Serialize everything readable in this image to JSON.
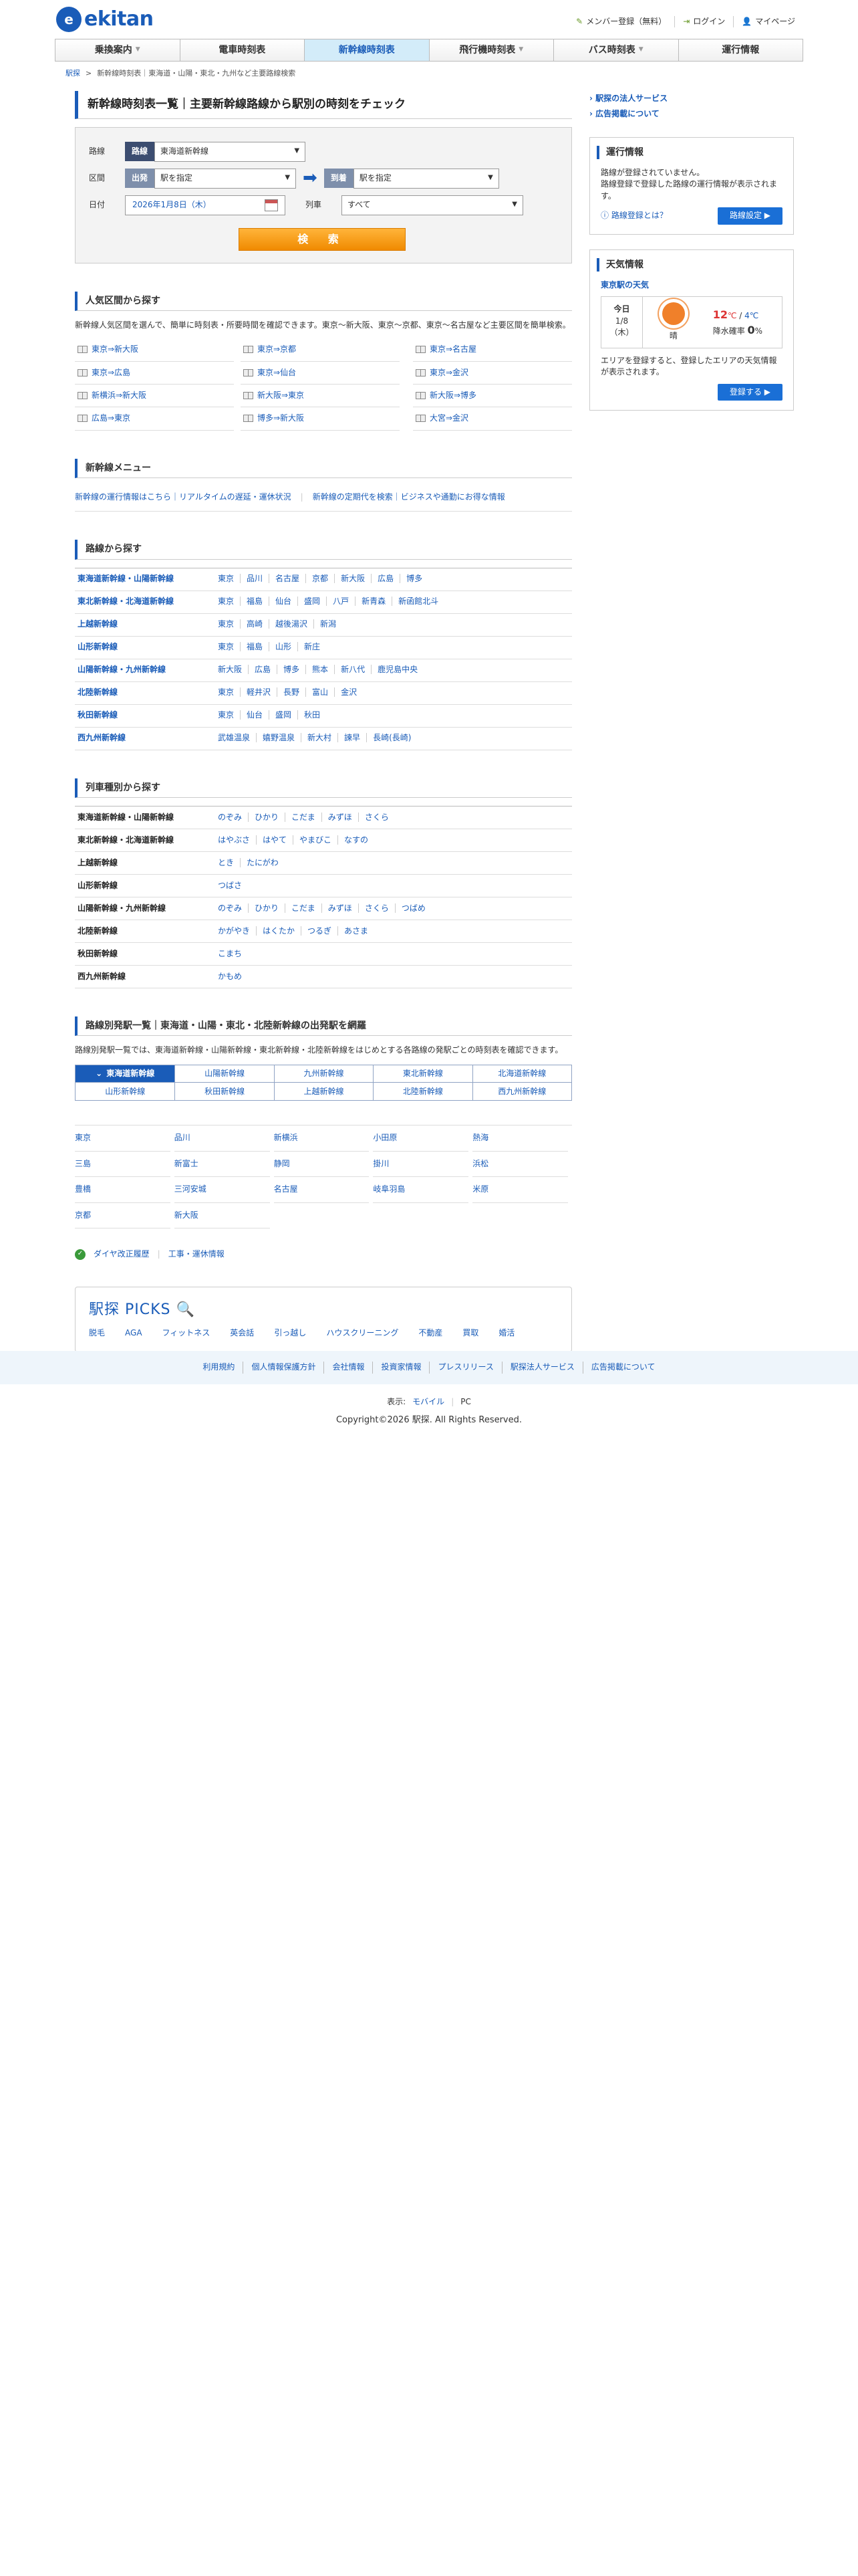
{
  "logo": {
    "mark": "e",
    "text": "ekitan"
  },
  "header_links": [
    {
      "label": "メンバー登録（無料）",
      "icon": "pencil-icon"
    },
    {
      "label": "ログイン",
      "icon": "login-icon"
    },
    {
      "label": "マイページ",
      "icon": "user-icon"
    }
  ],
  "gnav": [
    {
      "label": "乗換案内",
      "caret": "▼"
    },
    {
      "label": "電車時刻表",
      "caret": ""
    },
    {
      "label": "新幹線時刻表",
      "caret": ""
    },
    {
      "label": "飛行機時刻表",
      "caret": "▼"
    },
    {
      "label": "バス時刻表",
      "caret": "▼"
    },
    {
      "label": "運行情報",
      "caret": ""
    }
  ],
  "breadcrumb": {
    "home": "駅探",
    "sep": ">",
    "current": "新幹線時刻表｜東海道・山陽・東北・九州など主要路線検索"
  },
  "page_title": "新幹線時刻表一覧｜主要新幹線路線から駅別の時刻をチェック",
  "search": {
    "route_label": "路線",
    "route_tag": "路線",
    "route_value": "東海道新幹線",
    "section_label": "区間",
    "dep_tag": "出発",
    "dep_value": "駅を指定",
    "arr_tag": "到着",
    "arr_value": "駅を指定",
    "date_label": "日付",
    "date_value": "2026年1月8日（木）",
    "train_label": "列車",
    "train_value": "すべて",
    "button": "検 索",
    "tri": "▼",
    "arrow": "➡"
  },
  "popular": {
    "title": "人気区間から探す",
    "desc": "新幹線人気区間を選んで、簡単に時刻表・所要時間を確認できます。東京〜新大阪、東京〜京都、東京〜名古屋など主要区間を簡単検索。",
    "items": [
      "東京⇒新大阪",
      "東京⇒京都",
      "東京⇒名古屋",
      "東京⇒広島",
      "東京⇒仙台",
      "東京⇒金沢",
      "新横浜⇒新大阪",
      "新大阪⇒東京",
      "新大阪⇒博多",
      "広島⇒東京",
      "博多⇒新大阪",
      "大宮⇒金沢"
    ]
  },
  "menu": {
    "title": "新幹線メニュー",
    "link1": "新幹線の運行情報はこちら｜リアルタイムの遅延・運休状況",
    "link2": "新幹線の定期代を検索｜ビジネスや通勤にお得な情報",
    "sep": "|"
  },
  "lines": {
    "title": "路線から探す",
    "rows": [
      {
        "name": "東海道新幹線・山陽新幹線",
        "stations": [
          "東京",
          "品川",
          "名古屋",
          "京都",
          "新大阪",
          "広島",
          "博多"
        ]
      },
      {
        "name": "東北新幹線・北海道新幹線",
        "stations": [
          "東京",
          "福島",
          "仙台",
          "盛岡",
          "八戸",
          "新青森",
          "新函館北斗"
        ]
      },
      {
        "name": "上越新幹線",
        "stations": [
          "東京",
          "高崎",
          "越後湯沢",
          "新潟"
        ]
      },
      {
        "name": "山形新幹線",
        "stations": [
          "東京",
          "福島",
          "山形",
          "新庄"
        ]
      },
      {
        "name": "山陽新幹線・九州新幹線",
        "stations": [
          "新大阪",
          "広島",
          "博多",
          "熊本",
          "新八代",
          "鹿児島中央"
        ]
      },
      {
        "name": "北陸新幹線",
        "stations": [
          "東京",
          "軽井沢",
          "長野",
          "富山",
          "金沢"
        ]
      },
      {
        "name": "秋田新幹線",
        "stations": [
          "東京",
          "仙台",
          "盛岡",
          "秋田"
        ]
      },
      {
        "name": "西九州新幹線",
        "stations": [
          "武雄温泉",
          "嬉野温泉",
          "新大村",
          "諫早",
          "長崎(長崎)"
        ]
      }
    ]
  },
  "types": {
    "title": "列車種別から探す",
    "rows": [
      {
        "name": "東海道新幹線・山陽新幹線",
        "trains": [
          "のぞみ",
          "ひかり",
          "こだま",
          "みずほ",
          "さくら"
        ]
      },
      {
        "name": "東北新幹線・北海道新幹線",
        "trains": [
          "はやぶさ",
          "はやて",
          "やまびこ",
          "なすの"
        ]
      },
      {
        "name": "上越新幹線",
        "trains": [
          "とき",
          "たにがわ"
        ]
      },
      {
        "name": "山形新幹線",
        "trains": [
          "つばさ"
        ]
      },
      {
        "name": "山陽新幹線・九州新幹線",
        "trains": [
          "のぞみ",
          "ひかり",
          "こだま",
          "みずほ",
          "さくら",
          "つばめ"
        ]
      },
      {
        "name": "北陸新幹線",
        "trains": [
          "かがやき",
          "はくたか",
          "つるぎ",
          "あさま"
        ]
      },
      {
        "name": "秋田新幹線",
        "trains": [
          "こまち"
        ]
      },
      {
        "name": "西九州新幹線",
        "trains": [
          "かもめ"
        ]
      }
    ]
  },
  "station_list": {
    "title": "路線別発駅一覧｜東海道・山陽・東北・北陸新幹線の出発駅を網羅",
    "desc": "路線別発駅一覧では、東海道新幹線・山陽新幹線・東北新幹線・北陸新幹線をはじめとする各路線の発駅ごとの時刻表を確認できます。",
    "tabs": [
      "東海道新幹線",
      "山陽新幹線",
      "九州新幹線",
      "東北新幹線",
      "北海道新幹線",
      "山形新幹線",
      "秋田新幹線",
      "上越新幹線",
      "北陸新幹線",
      "西九州新幹線"
    ],
    "active_mark": "⌄",
    "stations": [
      "東京",
      "品川",
      "新横浜",
      "小田原",
      "熱海",
      "三島",
      "新富士",
      "静岡",
      "掛川",
      "浜松",
      "豊橋",
      "三河安城",
      "名古屋",
      "岐阜羽島",
      "米原",
      "京都",
      "新大阪"
    ]
  },
  "bottom_links": {
    "icon": "green-circle-icon",
    "link1": "ダイヤ改正履歴",
    "link2": "工事・運休情報"
  },
  "picks": {
    "logo": "駅探 PICKS",
    "links": [
      "脱毛",
      "AGA",
      "フィットネス",
      "英会話",
      "引っ越し",
      "ハウスクリーニング",
      "不動産",
      "買取",
      "婚活"
    ]
  },
  "side": {
    "links": [
      "駅探の法人サービス",
      "広告掲載について"
    ],
    "unko": {
      "title": "運行情報",
      "text1": "路線が登録されていません。",
      "text2": "路線登録で登録した路線の運行情報が表示されます。",
      "help": "路線登録とは？",
      "btn": "路線設定"
    },
    "weather": {
      "title": "天気情報",
      "station": "東京駅の天気",
      "today": "今日",
      "date": "1/8",
      "dow": "（木）",
      "cond": "晴",
      "hi": "12",
      "lo": "4",
      "unit": "℃",
      "pop_label": "降水確率",
      "pop": "0",
      "pop_unit": "%",
      "note": "エリアを登録すると、登録したエリアの天気情報が表示されます。",
      "btn": "登録する"
    }
  },
  "footer": {
    "links": [
      "利用規約",
      "個人情報保護方針",
      "会社情報",
      "投資家情報",
      "プレスリリース",
      "駅探法人サービス",
      "広告掲載について"
    ],
    "display_label": "表示:",
    "display_opts": [
      "モバイル",
      "PC"
    ],
    "copyright": "Copyright©2026 駅探. All Rights Reserved."
  }
}
